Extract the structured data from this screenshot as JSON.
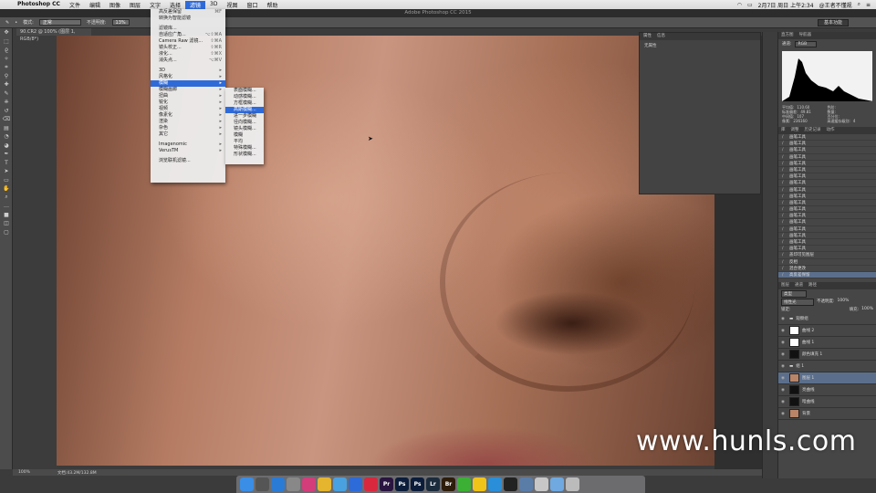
{
  "menubar": {
    "apple": "",
    "items": [
      "Photoshop CC",
      "文件",
      "编辑",
      "图像",
      "图层",
      "文字",
      "选择",
      "滤镜",
      "3D",
      "视图",
      "窗口",
      "帮助"
    ],
    "active_index": 7,
    "clock": "2月7日 周日 上午2:34",
    "user": "@王者不懂规"
  },
  "window_title": "Adobe Photoshop CC 2015",
  "options_bar": {
    "mode_label": "模式:",
    "mode_value": "正常",
    "opacity_label": "不透明度:",
    "opacity_value": "13%",
    "workspace": "基本功能"
  },
  "doc_tab": "90.CR2 @ 100% (图层 1, RGB/8*)",
  "filter_menu": [
    {
      "label": "高反差保留",
      "shortcut": "⌘F"
    },
    {
      "label": "转换为智能滤镜",
      "shortcut": ""
    },
    {
      "sep": true
    },
    {
      "label": "滤镜库...",
      "shortcut": ""
    },
    {
      "label": "自适应广角...",
      "shortcut": "⌥⇧⌘A"
    },
    {
      "label": "Camera Raw 滤镜...",
      "shortcut": "⇧⌘A"
    },
    {
      "label": "镜头校正...",
      "shortcut": "⇧⌘R"
    },
    {
      "label": "液化...",
      "shortcut": "⇧⌘X"
    },
    {
      "label": "消失点...",
      "shortcut": "⌥⌘V"
    },
    {
      "sep": true
    },
    {
      "label": "3D",
      "shortcut": "▸"
    },
    {
      "label": "风格化",
      "shortcut": "▸"
    },
    {
      "label": "模糊",
      "shortcut": "▸",
      "hl": true
    },
    {
      "label": "模糊画廊",
      "shortcut": "▸"
    },
    {
      "label": "扭曲",
      "shortcut": "▸"
    },
    {
      "label": "锐化",
      "shortcut": "▸"
    },
    {
      "label": "视频",
      "shortcut": "▸"
    },
    {
      "label": "像素化",
      "shortcut": "▸"
    },
    {
      "label": "渲染",
      "shortcut": "▸"
    },
    {
      "label": "杂色",
      "shortcut": "▸"
    },
    {
      "label": "其它",
      "shortcut": "▸"
    },
    {
      "sep": true
    },
    {
      "label": "Imagenomic",
      "shortcut": "▸"
    },
    {
      "label": "VerusTM",
      "shortcut": "▸"
    },
    {
      "sep": true
    },
    {
      "label": "浏览联机滤镜...",
      "shortcut": ""
    }
  ],
  "blur_submenu": [
    {
      "label": "表面模糊..."
    },
    {
      "label": "动感模糊..."
    },
    {
      "label": "方框模糊..."
    },
    {
      "label": "高斯模糊...",
      "hl": true
    },
    {
      "label": "进一步模糊"
    },
    {
      "label": "径向模糊..."
    },
    {
      "label": "镜头模糊..."
    },
    {
      "label": "模糊"
    },
    {
      "label": "平均"
    },
    {
      "label": "特殊模糊..."
    },
    {
      "label": "形状模糊..."
    }
  ],
  "properties_panel": {
    "tabs": [
      "属性",
      "信息"
    ],
    "body": "无属性"
  },
  "histogram": {
    "tabs": [
      "直方图",
      "导航器"
    ],
    "channel_label": "通道:",
    "channel": "RGB"
  },
  "stats": [
    [
      "平均值:",
      "110.60"
    ],
    [
      "色阶:",
      ""
    ],
    [
      "标准偏差:",
      "49.81"
    ],
    [
      "数量:",
      ""
    ],
    [
      "中间值:",
      "107"
    ],
    [
      "百分位:",
      ""
    ],
    [
      "像素:",
      "236160"
    ],
    [
      "高速缓存级别:",
      "4"
    ]
  ],
  "history_tabs": [
    "库",
    "调整",
    "历史记录",
    "动作"
  ],
  "history": [
    "画笔工具",
    "画笔工具",
    "画笔工具",
    "画笔工具",
    "画笔工具",
    "画笔工具",
    "画笔工具",
    "画笔工具",
    "画笔工具",
    "画笔工具",
    "画笔工具",
    "画笔工具",
    "画笔工具",
    "画笔工具",
    "画笔工具",
    "画笔工具",
    "画笔工具",
    "画笔工具",
    "盖印可见图层",
    "反相",
    "混合更改",
    "高反差保留"
  ],
  "history_selected": 21,
  "layers": {
    "tabs": [
      "图层",
      "通道",
      "路径"
    ],
    "kind": "类型",
    "blend": "线性光",
    "opacity_label": "不透明度:",
    "opacity": "100%",
    "lock_label": "锁定:",
    "fill_label": "填充:",
    "fill": "100%",
    "rows": [
      {
        "name": "观察组",
        "thumb": "group"
      },
      {
        "name": "曲线 2",
        "thumb": "white"
      },
      {
        "name": "曲线 1",
        "thumb": "white"
      },
      {
        "name": "颜色填充 1",
        "thumb": "dark"
      },
      {
        "name": "组 1",
        "thumb": "group"
      },
      {
        "name": "图层 1",
        "thumb": "skin",
        "sel": true
      },
      {
        "name": "亮曲线",
        "thumb": "dark"
      },
      {
        "name": "暗曲线",
        "thumb": "dark"
      },
      {
        "name": "背景",
        "thumb": "skin"
      }
    ]
  },
  "status": {
    "zoom": "100%",
    "doc": "文档:43.2M/132.8M"
  },
  "watermark": "www.hunls.com",
  "dock": [
    {
      "icon": "finder-icon",
      "color": "#3a8ee6",
      "t": ""
    },
    {
      "icon": "launchpad-icon",
      "color": "#555",
      "t": ""
    },
    {
      "icon": "safari-icon",
      "color": "#2a7bd6",
      "t": ""
    },
    {
      "icon": "system-prefs-icon",
      "color": "#888",
      "t": ""
    },
    {
      "icon": "finalcut-icon",
      "color": "#d23d7a",
      "t": ""
    },
    {
      "icon": "chrome-icon",
      "color": "#e5b52f",
      "t": ""
    },
    {
      "icon": "mail-icon",
      "color": "#4aa1e0",
      "t": ""
    },
    {
      "icon": "airmail-icon",
      "color": "#2d6bd8",
      "t": ""
    },
    {
      "icon": "music-icon",
      "color": "#d8283e",
      "t": ""
    },
    {
      "icon": "premiere-icon",
      "color": "#2a1440",
      "t": "Pr"
    },
    {
      "icon": "photoshop-icon",
      "color": "#0b1d3a",
      "t": "Ps"
    },
    {
      "icon": "photoshop2-icon",
      "color": "#0b1d3a",
      "t": "Ps"
    },
    {
      "icon": "lightroom-icon",
      "color": "#1b2c3d",
      "t": "Lr"
    },
    {
      "icon": "bridge-icon",
      "color": "#2d1d0a",
      "t": "Br"
    },
    {
      "icon": "wechat-icon",
      "color": "#3cb034",
      "t": ""
    },
    {
      "icon": "qq-icon",
      "color": "#f0c419",
      "t": ""
    },
    {
      "icon": "qq-browser-icon",
      "color": "#2a8fd8",
      "t": ""
    },
    {
      "icon": "notes-icon",
      "color": "#222",
      "t": ""
    },
    {
      "icon": "phone-icon",
      "color": "#5a7da8",
      "t": ""
    },
    {
      "icon": "preview-icon",
      "color": "#c7c7c7",
      "t": ""
    },
    {
      "icon": "folder-icon",
      "color": "#6fa9e0",
      "t": ""
    },
    {
      "icon": "trash-icon",
      "color": "#bbb",
      "t": ""
    }
  ]
}
